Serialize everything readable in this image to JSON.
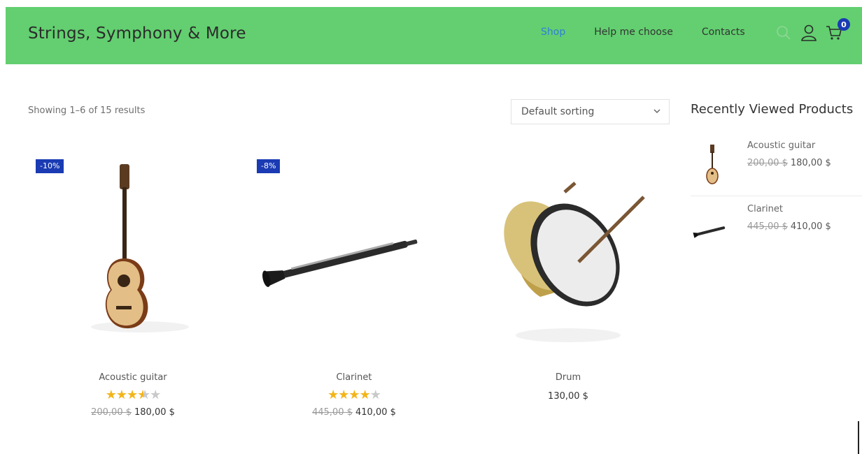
{
  "header": {
    "brand": "Strings, Symphony & More",
    "nav": [
      {
        "label": "Shop",
        "active": true
      },
      {
        "label": "Help me choose",
        "active": false
      },
      {
        "label": "Contacts",
        "active": false
      }
    ],
    "icons": [
      "search-icon",
      "user-icon",
      "cart-icon"
    ],
    "cart_count": "0"
  },
  "shop": {
    "result_count": "Showing 1–6 of 15 results",
    "sorting": "Default sorting"
  },
  "products": [
    {
      "name": "Acoustic guitar",
      "badge": "-10%",
      "rating": 3.5,
      "old_price": "200,00 $",
      "price": "180,00 $",
      "image": "guitar"
    },
    {
      "name": "Clarinet",
      "badge": "-8%",
      "rating": 4,
      "old_price": "445,00 $",
      "price": "410,00 $",
      "image": "clarinet"
    },
    {
      "name": "Drum",
      "badge": "",
      "rating": null,
      "old_price": "",
      "price": "130,00 $",
      "image": "drum"
    }
  ],
  "sidebar": {
    "title": "Recently Viewed Products",
    "items": [
      {
        "name": "Acoustic guitar",
        "old_price": "200,00 $",
        "price": "180,00 $"
      },
      {
        "name": "Clarinet",
        "old_price": "445,00 $",
        "price": "410,00 $"
      }
    ]
  },
  "colors": {
    "header_bg": "#63cf70",
    "accent": "#2f7fd8",
    "badge": "#1a3bb3",
    "star": "#f3b51b"
  }
}
